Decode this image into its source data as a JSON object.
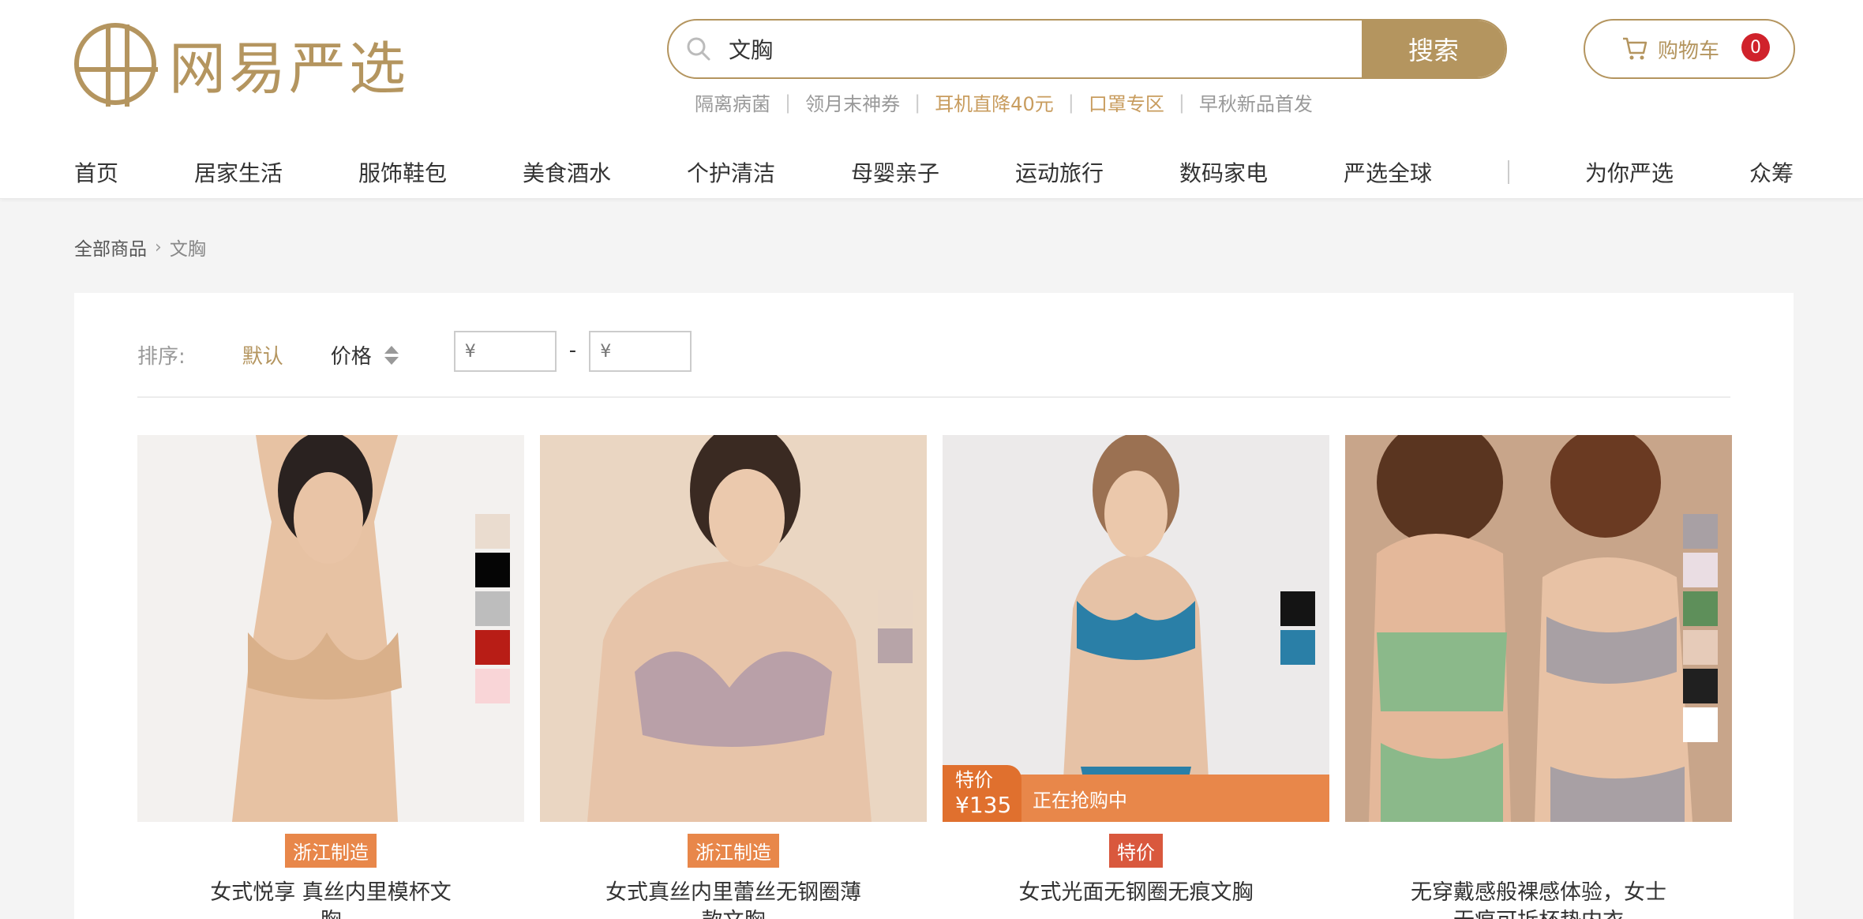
{
  "logo": {
    "text": "网易严选"
  },
  "search": {
    "value": "文胸",
    "button_label": "搜索"
  },
  "hot_words": [
    {
      "text": "隔离病菌",
      "highlight": false
    },
    {
      "text": "领月末神券",
      "highlight": false
    },
    {
      "text": "耳机直降40元",
      "highlight": true
    },
    {
      "text": "口罩专区",
      "highlight": true
    },
    {
      "text": "早秋新品首发",
      "highlight": false
    }
  ],
  "cart": {
    "label": "购物车",
    "count": "0"
  },
  "nav": [
    "首页",
    "居家生活",
    "服饰鞋包",
    "美食酒水",
    "个护清洁",
    "母婴亲子",
    "运动旅行",
    "数码家电",
    "严选全球",
    "为你严选",
    "众筹"
  ],
  "breadcrumb": {
    "root": "全部商品",
    "current": "文胸"
  },
  "sort": {
    "label": "排序:",
    "default": "默认",
    "price": "价格",
    "min_placeholder": "¥",
    "max_placeholder": "¥",
    "dash": "-"
  },
  "products": [
    {
      "tag": "浙江制造",
      "tag_color": "#e8874a",
      "title": "女式悦享 真丝内里模杯文胸",
      "swatches": [
        "#eadccf",
        "#050505",
        "#bdbdbd",
        "#b81d16",
        "#f9d5d7"
      ]
    },
    {
      "tag": "浙江制造",
      "tag_color": "#e8874a",
      "title": "女式真丝内里蕾丝无钢圈薄款文胸",
      "swatches": [
        "#e9d5c3",
        "#b7a4a8"
      ]
    },
    {
      "tag": "特价",
      "tag_color": "#d9583d",
      "title": "女式光面无钢圈无痕文胸",
      "swatches": [
        "#141414",
        "#2a7fa7"
      ],
      "promo": {
        "label": "特价",
        "price": "¥135",
        "text": "正在抢购中"
      }
    },
    {
      "tag": "",
      "tag_color": "",
      "title": "无穿戴感般裸感体验，女士无痕可拆杯垫内衣",
      "swatches": [
        "#a8a0a4",
        "#eadde3",
        "#5e8f5a",
        "#e6cbb9",
        "#202020",
        "#ffffff"
      ]
    }
  ],
  "colors": {
    "brand": "#b4955f",
    "badge": "#d0222b"
  }
}
